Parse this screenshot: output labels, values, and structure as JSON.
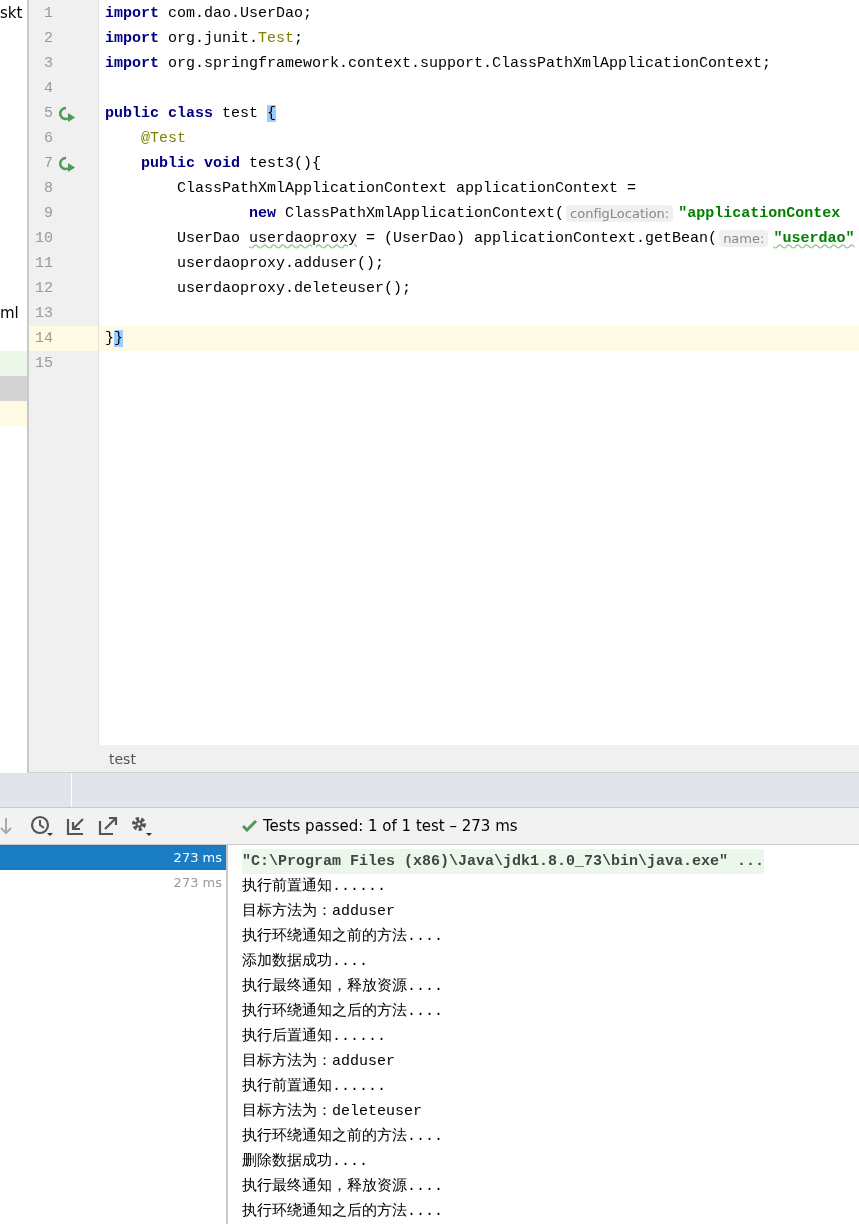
{
  "sidebar": {
    "items": [
      {
        "label": "skt"
      },
      {
        "label": "ml"
      }
    ]
  },
  "editor": {
    "lines": [
      {
        "number": "1",
        "current": false,
        "runnable": false,
        "tokens": [
          {
            "kind": "keyword",
            "text": "import"
          },
          {
            "kind": "text",
            "text": " com.dao.UserDao;"
          }
        ]
      },
      {
        "number": "2",
        "current": false,
        "runnable": false,
        "tokens": [
          {
            "kind": "keyword",
            "text": "import"
          },
          {
            "kind": "text",
            "text": " org.junit."
          },
          {
            "kind": "annotation",
            "text": "Test"
          },
          {
            "kind": "text",
            "text": ";"
          }
        ]
      },
      {
        "number": "3",
        "current": false,
        "runnable": false,
        "tokens": [
          {
            "kind": "keyword",
            "text": "import"
          },
          {
            "kind": "text",
            "text": " org.springframework.context.support.ClassPathXmlApplicationContext;"
          }
        ]
      },
      {
        "number": "4",
        "current": false,
        "runnable": false
      },
      {
        "number": "5",
        "current": false,
        "runnable": true,
        "tokens": [
          {
            "kind": "keyword",
            "text": "public class"
          },
          {
            "kind": "text",
            "text": " test "
          },
          {
            "kind": "brace",
            "text": "{"
          }
        ]
      },
      {
        "number": "6",
        "current": false,
        "runnable": false,
        "tokens": [
          {
            "kind": "annotation",
            "text": "    @Test"
          }
        ]
      },
      {
        "number": "7",
        "current": false,
        "runnable": true,
        "tokens": [
          {
            "kind": "keyword",
            "text": "    public void"
          },
          {
            "kind": "text",
            "text": " test3(){"
          }
        ]
      },
      {
        "number": "8",
        "current": false,
        "runnable": false,
        "tokens": [
          {
            "kind": "text",
            "text": "        ClassPathXmlApplicationContext applicationContext ="
          }
        ]
      },
      {
        "number": "9",
        "current": false,
        "runnable": false,
        "tokens": [
          {
            "kind": "keyword",
            "text": "                new"
          },
          {
            "kind": "text",
            "text": " ClassPathXmlApplicationContext("
          },
          {
            "kind": "hint",
            "text": "configLocation:"
          },
          {
            "kind": "string",
            "text": "\"applicationContex"
          }
        ]
      },
      {
        "number": "10",
        "current": false,
        "runnable": false,
        "tokens": [
          {
            "kind": "text",
            "text": "        UserDao "
          },
          {
            "kind": "unused",
            "text": "userdaoproxy"
          },
          {
            "kind": "text",
            "text": " = (UserDao) applicationContext.getBean("
          },
          {
            "kind": "hint",
            "text": "name:"
          },
          {
            "kind": "unused-string",
            "text": "\"userdao\""
          }
        ]
      },
      {
        "number": "11",
        "current": false,
        "runnable": false,
        "tokens": [
          {
            "kind": "text",
            "text": "        userdaoproxy.adduser();"
          }
        ]
      },
      {
        "number": "12",
        "current": false,
        "runnable": false,
        "tokens": [
          {
            "kind": "text",
            "text": "        userdaoproxy.deleteuser();"
          }
        ]
      },
      {
        "number": "13",
        "current": false,
        "runnable": false
      },
      {
        "number": "14",
        "current": true,
        "runnable": false,
        "tokens": [
          {
            "kind": "text",
            "text": "}"
          },
          {
            "kind": "brace",
            "text": "}"
          }
        ]
      },
      {
        "number": "15",
        "current": false,
        "runnable": false
      }
    ]
  },
  "breadcrumb": "test",
  "run": {
    "status": "Tests passed: 1 of 1 test – 273 ms",
    "tree": [
      {
        "time": "273 ms",
        "selected": true
      },
      {
        "time": "273 ms",
        "selected": false
      }
    ],
    "console": [
      {
        "kind": "command",
        "text": "\"C:\\Program Files (x86)\\Java\\jdk1.8.0_73\\bin\\java.exe\" ..."
      },
      {
        "kind": "output",
        "text": "执行前置通知......"
      },
      {
        "kind": "output",
        "text": "目标方法为：adduser"
      },
      {
        "kind": "output",
        "text": "执行环绕通知之前的方法...."
      },
      {
        "kind": "output",
        "text": "添加数据成功...."
      },
      {
        "kind": "output",
        "text": "执行最终通知，释放资源...."
      },
      {
        "kind": "output",
        "text": "执行环绕通知之后的方法...."
      },
      {
        "kind": "output",
        "text": "执行后置通知......"
      },
      {
        "kind": "output",
        "text": "目标方法为：adduser"
      },
      {
        "kind": "output",
        "text": "执行前置通知......"
      },
      {
        "kind": "output",
        "text": "目标方法为：deleteuser"
      },
      {
        "kind": "output",
        "text": "执行环绕通知之前的方法...."
      },
      {
        "kind": "output",
        "text": "删除数据成功...."
      },
      {
        "kind": "output",
        "text": "执行最终通知，释放资源...."
      },
      {
        "kind": "output",
        "text": "执行环绕通知之后的方法...."
      }
    ]
  }
}
